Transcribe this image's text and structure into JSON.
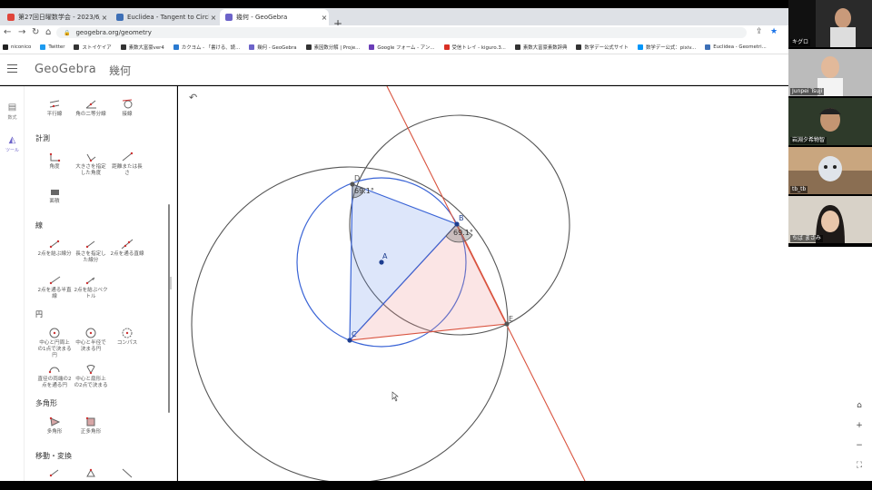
{
  "browser": {
    "tabs": [
      {
        "title": "第27回日曜数学会 - 2023/6/25",
        "fav_color": "#e0453a"
      },
      {
        "title": "Euclidea - Tangent to Circle at P",
        "fav_color": "#3d6fb6"
      },
      {
        "title": "幾何 - GeoGebra",
        "fav_color": "#6c63c9"
      }
    ],
    "new_tab": "+",
    "url": "geogebra.org/geometry",
    "nav": {
      "back": "←",
      "forward": "→",
      "reload": "↻",
      "home": "⌂"
    },
    "bookmarks": [
      {
        "label": "niconico",
        "color": "#222"
      },
      {
        "label": "Twitter",
        "color": "#1d9bf0"
      },
      {
        "label": "ストイケイア",
        "color": "#333"
      },
      {
        "label": "素数大富豪ver4",
        "color": "#333"
      },
      {
        "label": "カクヨム - 「書ける、読...",
        "color": "#2a7ad0"
      },
      {
        "label": "幾何 - GeoGebra",
        "color": "#6c63c9"
      },
      {
        "label": "素因数分解 | Proje...",
        "color": "#333"
      },
      {
        "label": "Google フォーム - アン...",
        "color": "#6a3db8"
      },
      {
        "label": "受信トレイ - kiguro.3...",
        "color": "#d93025"
      },
      {
        "label": "素数大富豪素数辞典",
        "color": "#333"
      },
      {
        "label": "数学デー公式サイト",
        "color": "#333"
      },
      {
        "label": "数学デー公式：pixiv...",
        "color": "#0096fa"
      },
      {
        "label": "Euclidea - Geometri...",
        "color": "#3d6fb6"
      }
    ]
  },
  "app": {
    "logo": "GeoGebra",
    "title": "幾何",
    "rail": [
      {
        "label": "数式",
        "icon": "calculator-icon"
      },
      {
        "label": "ツール",
        "icon": "tools-icon"
      }
    ],
    "categories": [
      {
        "name": "計測",
        "tools": [
          "角度",
          "大きさを指定した角度",
          "距離または長さ",
          "面積"
        ]
      },
      {
        "name": "線",
        "tools": [
          "2点を結ぶ線分",
          "長さを指定した線分",
          "2点を通る直線",
          "2点を通る半直線",
          "2点を結ぶベクトル"
        ]
      },
      {
        "name": "円",
        "tools": [
          "中心と円周上の1点で決まる円",
          "中心と半径で決まる円",
          "コンパス",
          "直径の両端の2点を通る円",
          "中心と扇形上の2点で決まる"
        ]
      },
      {
        "name": "多角形",
        "tools": [
          "多角形",
          "正多角形"
        ]
      },
      {
        "name": "移動・変換",
        "tools": []
      }
    ],
    "top_tools": [
      "平行線",
      "角の二等分線",
      "接線"
    ]
  },
  "geometry": {
    "points": [
      "A",
      "B",
      "C",
      "D",
      "E"
    ],
    "angle_D": "69.1°",
    "angle_B": "69.1°"
  },
  "canvas_controls": {
    "undo": "↶",
    "home": "⌂",
    "zoom_in": "+",
    "zoom_out": "−",
    "fullscreen": "⛶"
  },
  "participants": [
    {
      "name": "キグロ"
    },
    {
      "name": "Junpei Tsuji"
    },
    {
      "name": "岩淵夕希物智"
    },
    {
      "name": "tb_tb"
    },
    {
      "name": "ちば まさみ"
    }
  ]
}
